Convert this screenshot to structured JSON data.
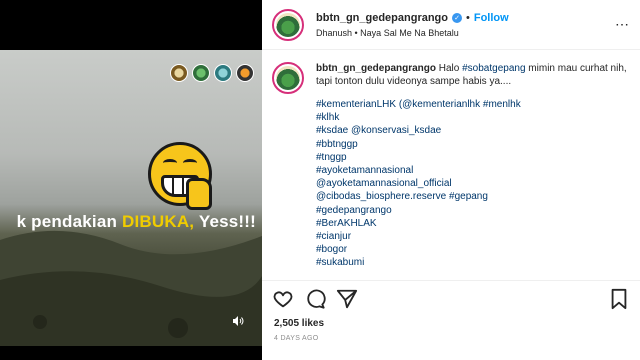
{
  "video": {
    "overlay_text_start": "k pendakian ",
    "overlay_text_highlight": "DIBUKA,",
    "overlay_text_end": " Yess!!!",
    "logo_icons": [
      "partner-logo-1-icon",
      "partner-logo-2-icon",
      "partner-logo-3-icon",
      "partner-logo-4-icon"
    ],
    "sound_icon": "speaker-icon"
  },
  "header": {
    "username": "bbtn_gn_gedepangrango",
    "verified_icon": "verified-badge-icon",
    "separator": "•",
    "follow_label": "Follow",
    "audio_line": "Dhanush • Naya Sal Me Na Bhetalu"
  },
  "caption": {
    "username": "bbtn_gn_gedepangrango",
    "text_before": " Halo ",
    "hashtag": "#sobatgepang",
    "text_after": " mimin mau curhat nih, tapi tonton dulu videonya sampe habis ya....",
    "lines": [
      "#kementerianLHK (@kementerianlhk #menlhk",
      "#klhk",
      "#ksdae @konservasi_ksdae",
      "#bbtnggp",
      "#tnggp",
      "#ayoketamannasional",
      "@ayoketamannasional_official",
      "@cibodas_biosphere.reserve #gepang",
      "#gedepangrango",
      "#BerAKHLAK",
      "#cianjur",
      "#bogor",
      "#sukabumi"
    ]
  },
  "actions": {
    "like_icon": "heart-icon",
    "comment_icon": "comment-icon",
    "share_icon": "send-icon",
    "save_icon": "bookmark-icon"
  },
  "stats": {
    "likes": "2,505 likes",
    "date": "4 DAYS AGO"
  },
  "colors": {
    "highlight": "#f0cc00",
    "link": "#00376b",
    "follow": "#0095f6"
  }
}
